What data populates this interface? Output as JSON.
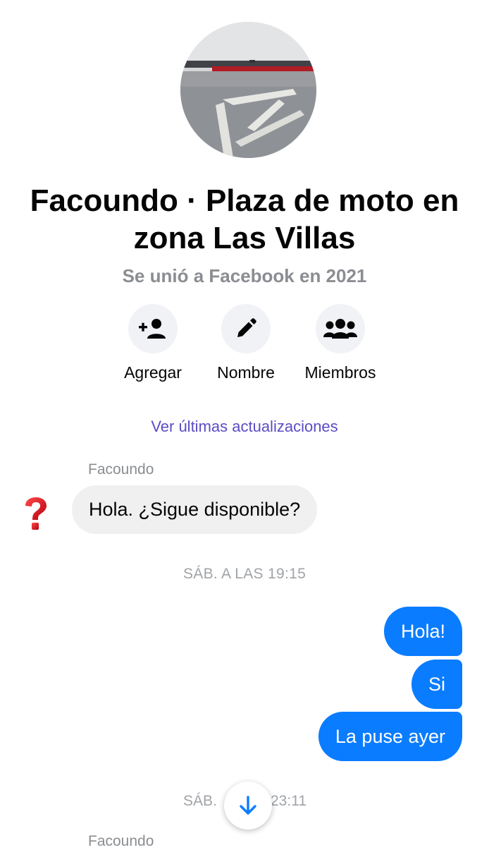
{
  "profile": {
    "title": "Facoundo · Plaza de moto en zona Las Villas",
    "subtitle": "Se unió a Facebook en 2021"
  },
  "actions": [
    {
      "label": "Agregar",
      "icon": "add-person-icon"
    },
    {
      "label": "Nombre",
      "icon": "pencil-icon"
    },
    {
      "label": "Miembros",
      "icon": "group-icon"
    }
  ],
  "updates_link": "Ver últimas actualizaciones",
  "messages": {
    "incoming_1": {
      "sender": "Facoundo",
      "text": "Hola. ¿Sigue disponible?"
    },
    "timestamp_1": "SÁB. A LAS 19:15",
    "outgoing": [
      "Hola!",
      "Si",
      "La puse ayer"
    ],
    "timestamp_2_start": "SÁB.",
    "timestamp_2_end": "23:11",
    "incoming_2_sender": "Facoundo"
  },
  "colors": {
    "outgoing_bubble": "#0a7cff",
    "incoming_bubble": "#f0f0f0",
    "link": "#5b4cc4",
    "question_mark": "#e0141e"
  }
}
